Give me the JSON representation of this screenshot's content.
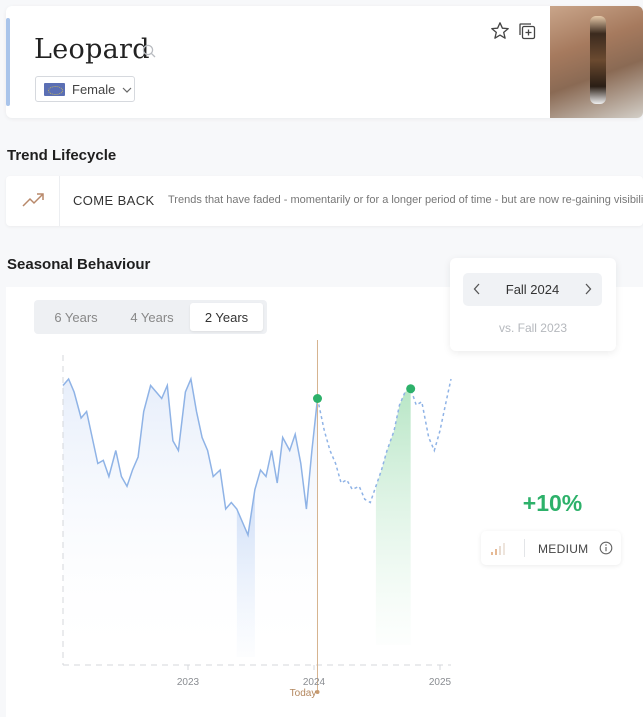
{
  "trend": {
    "title": "Leopard",
    "gender": "Female"
  },
  "lifecycle": {
    "section_title": "Trend Lifecycle",
    "stage": "COME BACK",
    "description": "Trends that have faded - momentarily or for a longer period of time - but are now re-gaining visibility"
  },
  "seasonal": {
    "section_title": "Seasonal Behaviour",
    "tabs": [
      "6 Years",
      "4 Years",
      "2 Years"
    ],
    "active_tab": "2 Years",
    "season": "Fall 2024",
    "compare": "vs. Fall 2023",
    "growth": "+10%",
    "volume": "MEDIUM"
  },
  "colors": {
    "accent": "#a9c4ea",
    "history_line": "#8fb3e6",
    "forecast_line": "#8fb3e6",
    "forecast_point": "#2db16a",
    "growth": "#2db16a",
    "today_line": "#d6b48f"
  },
  "icons": {
    "search": "search-icon",
    "star": "star-icon",
    "add": "add-to-board-icon",
    "lifecycle": "trend-up-arrow-icon",
    "volume": "signal-bars-icon",
    "info": "info-icon"
  },
  "chart_data": {
    "type": "line",
    "x_ticks": [
      "2023",
      "2024",
      "2025"
    ],
    "today_label": "Today",
    "history": {
      "x": [
        2022.25,
        2022.29,
        2022.33,
        2022.38,
        2022.42,
        2022.46,
        2022.5,
        2022.54,
        2022.58,
        2022.63,
        2022.67,
        2022.71,
        2022.75,
        2022.79,
        2022.83,
        2022.88,
        2022.92,
        2022.96,
        2023.0,
        2023.04,
        2023.08,
        2023.13,
        2023.17,
        2023.21,
        2023.25,
        2023.29,
        2023.33,
        2023.38,
        2023.42,
        2023.46,
        2023.5,
        2023.54,
        2023.58,
        2023.63,
        2023.67,
        2023.71,
        2023.75,
        2023.79,
        2023.83,
        2023.88,
        2023.92,
        2023.96,
        2024.0,
        2024.04,
        2024.08
      ],
      "y": [
        86,
        88,
        84,
        76,
        78,
        70,
        62,
        63,
        58,
        66,
        58,
        55,
        60,
        64,
        78,
        86,
        84,
        82,
        86,
        69,
        66,
        84,
        88,
        78,
        70,
        66,
        58,
        60,
        48,
        50,
        48,
        44,
        40,
        54,
        60,
        58,
        66,
        56,
        70,
        66,
        71,
        62,
        48,
        66,
        82
      ]
    },
    "forecast": {
      "x": [
        2024.08,
        2024.13,
        2024.17,
        2024.21,
        2024.25,
        2024.29,
        2024.33,
        2024.38,
        2024.42,
        2024.46,
        2024.5,
        2024.54,
        2024.58,
        2024.63,
        2024.67,
        2024.71,
        2024.75,
        2024.79,
        2024.83,
        2024.88,
        2024.92,
        2024.96,
        2025.0,
        2025.04
      ],
      "y": [
        82,
        72,
        66,
        62,
        56,
        57,
        54,
        55,
        51,
        50,
        55,
        60,
        66,
        72,
        80,
        84,
        85,
        80,
        81,
        70,
        66,
        72,
        80,
        88
      ]
    },
    "highlight_last_year": [
      2023.5,
      2023.63
    ],
    "highlight_this_year": [
      2024.5,
      2024.75
    ],
    "ylim": [
      0,
      100
    ],
    "grid": false
  }
}
